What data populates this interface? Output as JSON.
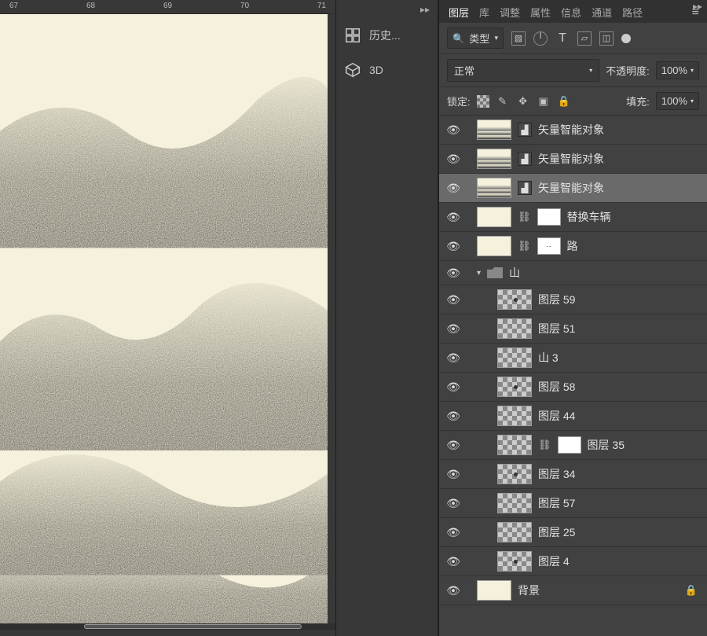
{
  "ruler": {
    "marks": [
      "67",
      "68",
      "69",
      "70",
      "71"
    ]
  },
  "dock": {
    "history": "历史...",
    "three_d": "3D"
  },
  "panel": {
    "tabs": [
      "图层",
      "库",
      "调整",
      "属性",
      "信息",
      "通道",
      "路径"
    ],
    "active_tab": 0,
    "type_filter_label": "类型",
    "blend_mode": "正常",
    "opacity_label": "不透明度:",
    "opacity_value": "100%",
    "lock_label": "锁定:",
    "fill_label": "填充:",
    "fill_value": "100%"
  },
  "layers": [
    {
      "id": "so1",
      "name": "矢量智能对象",
      "kind": "smart",
      "indent": 0,
      "selected": false,
      "visible": true
    },
    {
      "id": "so2",
      "name": "矢量智能对象",
      "kind": "smart",
      "indent": 0,
      "selected": false,
      "visible": true
    },
    {
      "id": "so3",
      "name": "矢量智能对象",
      "kind": "smart",
      "indent": 0,
      "selected": true,
      "visible": true
    },
    {
      "id": "rep",
      "name": "替换车辆",
      "kind": "masked-white",
      "indent": 0,
      "selected": false,
      "visible": true
    },
    {
      "id": "road",
      "name": "路",
      "kind": "masked-dots",
      "indent": 0,
      "selected": false,
      "visible": true
    },
    {
      "id": "grp",
      "name": "山",
      "kind": "folder",
      "indent": 0,
      "selected": false,
      "visible": true
    },
    {
      "id": "l59",
      "name": "图层 59",
      "kind": "checker",
      "indent": 1,
      "selected": false,
      "visible": true
    },
    {
      "id": "l51",
      "name": "图层 51",
      "kind": "checker",
      "indent": 1,
      "selected": false,
      "visible": true
    },
    {
      "id": "m3",
      "name": "山 3",
      "kind": "checker",
      "indent": 1,
      "selected": false,
      "visible": true
    },
    {
      "id": "l58",
      "name": "图层 58",
      "kind": "checker",
      "indent": 1,
      "selected": false,
      "visible": true
    },
    {
      "id": "l44",
      "name": "图层 44",
      "kind": "checker",
      "indent": 1,
      "selected": false,
      "visible": true
    },
    {
      "id": "l35",
      "name": "图层 35",
      "kind": "masked-chk",
      "indent": 1,
      "selected": false,
      "visible": true
    },
    {
      "id": "l34",
      "name": "图层 34",
      "kind": "checker",
      "indent": 1,
      "selected": false,
      "visible": true
    },
    {
      "id": "l57",
      "name": "图层 57",
      "kind": "checker",
      "indent": 1,
      "selected": false,
      "visible": true
    },
    {
      "id": "l25",
      "name": "图层 25",
      "kind": "checker",
      "indent": 1,
      "selected": false,
      "visible": true
    },
    {
      "id": "l4",
      "name": "图层 4",
      "kind": "checker",
      "indent": 1,
      "selected": false,
      "visible": true
    },
    {
      "id": "bg",
      "name": "背景",
      "kind": "bg",
      "indent": 0,
      "selected": false,
      "visible": true,
      "locked": true
    }
  ]
}
